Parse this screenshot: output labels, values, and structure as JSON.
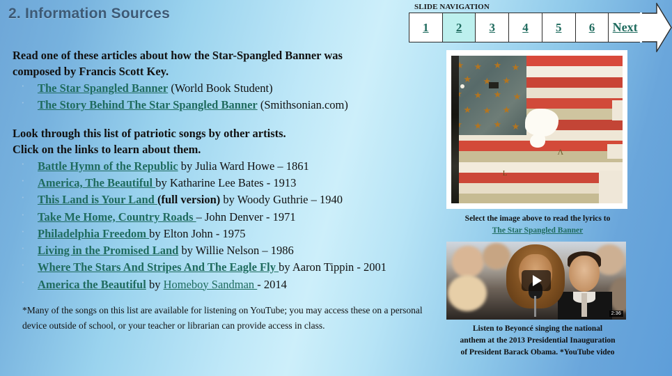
{
  "slide": {
    "title": "2. Information Sources"
  },
  "nav": {
    "label": "SLIDE NAVIGATION",
    "items": [
      {
        "label": "1",
        "active": false
      },
      {
        "label": "2",
        "active": true
      },
      {
        "label": "3",
        "active": false
      },
      {
        "label": "4",
        "active": false
      },
      {
        "label": "5",
        "active": false
      },
      {
        "label": "6",
        "active": false
      },
      {
        "label": "Next",
        "active": false
      }
    ]
  },
  "section1": {
    "heading_line1": "Read one of these articles about how the Star-Spangled Banner was",
    "heading_line2": "composed by Francis Scott Key.",
    "items": [
      {
        "link": "The Star Spangled Banner",
        "rest": " (World Book Student)"
      },
      {
        "link": "The Story Behind The Star Spangled Banner",
        "rest": " (Smithsonian.com)"
      }
    ]
  },
  "section2": {
    "heading_line1": "Look through this list of patriotic songs by other artists.",
    "heading_line2": "Click on the links to learn about them.",
    "songs": [
      {
        "link": "Battle Hymn of the Republic",
        "rest": " by Julia Ward Howe – 1861"
      },
      {
        "link": "America, The Beautiful ",
        "rest": "by Katharine Lee Bates - 1913"
      },
      {
        "link": "This Land is Your Land ",
        "bold": "(full version)",
        "rest": " by Woody Guthrie – 1940"
      },
      {
        "link": "Take Me Home, Country Roads ",
        "rest": "– John Denver - 1971"
      },
      {
        "link": "Philadelphia Freedom ",
        "rest": "by Elton John - 1975"
      },
      {
        "link": "Living in the Promised Land",
        "rest": " by Willie Nelson – 1986"
      },
      {
        "link": "Where The Stars And Stripes And The Eagle Fly ",
        "rest": "by Aaron Tippin - 2001"
      },
      {
        "link": "America the Beautiful",
        "rest": " by ",
        "link2": "Homeboy Sandman ",
        "rest2": "- 2014"
      }
    ]
  },
  "footnote": "*Many of the songs on this list are available for listening on YouTube; you may access these on a personal device outside of school, or your teacher or librarian can provide access in class.",
  "flag": {
    "alt": "star-spangled-banner-flag",
    "caption_line1": "Select the image above to read the lyrics to",
    "caption_link": "The Star Spangled Banner"
  },
  "video": {
    "alt": "beyonce-national-anthem-thumbnail",
    "duration": "2:36",
    "caption_line1": "Listen to Beyoncé singing the national",
    "caption_line2": "anthem at the 2013 Presidential Inauguration",
    "caption_line3": "of President Barack Obama.  *YouTube video"
  },
  "colors": {
    "title": "#3d5a76",
    "link": "#1f6b5e",
    "nav_active": "#bdf0ee",
    "bg_left": "#6ea7d8",
    "bg_center": "#cdeffa",
    "bg_right": "#5e9ed9"
  }
}
